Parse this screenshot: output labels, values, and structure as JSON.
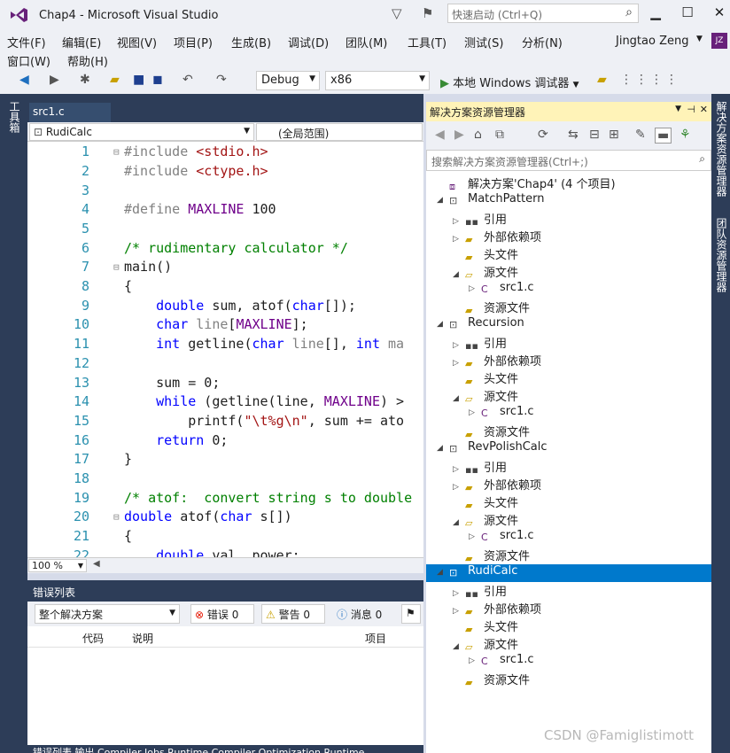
{
  "window": {
    "title": "Chap4 - Microsoft Visual Studio",
    "quick_launch": "快速启动 (Ctrl+Q)",
    "user": "Jingtao Zeng",
    "avatar": "JZ"
  },
  "menu": [
    "文件(F)",
    "编辑(E)",
    "视图(V)",
    "项目(P)",
    "生成(B)",
    "调试(D)",
    "团队(M)",
    "工具(T)",
    "测试(S)",
    "分析(N)",
    "窗口(W)",
    "帮助(H)"
  ],
  "toolbar": {
    "config": "Debug",
    "platform": "x86",
    "run_label": "本地 Windows 调试器"
  },
  "left_tab": "工具箱",
  "right_tabs": [
    "解决方案资源管理器",
    "团队资源管理器"
  ],
  "editor": {
    "tab": "src1.c",
    "scope_left": "RudiCalc",
    "scope_right": "(全局范围)",
    "zoom": "100 %",
    "lines": [
      {
        "n": "1",
        "t": "#include <stdio.h>"
      },
      {
        "n": "2",
        "t": "#include <ctype.h>"
      },
      {
        "n": "3",
        "t": ""
      },
      {
        "n": "4",
        "t": "#define MAXLINE 100"
      },
      {
        "n": "5",
        "t": ""
      },
      {
        "n": "6",
        "t": "/* rudimentary calculator */"
      },
      {
        "n": "7",
        "t": "main()"
      },
      {
        "n": "8",
        "t": "{"
      },
      {
        "n": "9",
        "t": "    double sum, atof(char[]);"
      },
      {
        "n": "10",
        "t": "    char line[MAXLINE];"
      },
      {
        "n": "11",
        "t": "    int getline(char line[], int ma"
      },
      {
        "n": "12",
        "t": ""
      },
      {
        "n": "13",
        "t": "    sum = 0;"
      },
      {
        "n": "14",
        "t": "    while (getline(line, MAXLINE) >"
      },
      {
        "n": "15",
        "t": "        printf(\"\\t%g\\n\", sum += ato"
      },
      {
        "n": "16",
        "t": "    return 0;"
      },
      {
        "n": "17",
        "t": "}"
      },
      {
        "n": "18",
        "t": ""
      },
      {
        "n": "19",
        "t": "/* atof:  convert string s to double"
      },
      {
        "n": "20",
        "t": "double atof(char s[])"
      },
      {
        "n": "21",
        "t": "{"
      },
      {
        "n": "22",
        "t": "    double val, power;"
      }
    ]
  },
  "error_list": {
    "title": "错误列表",
    "scope": "整个解决方案",
    "errors": "错误 0",
    "warnings": "警告 0",
    "messages": "消息 0",
    "col_code": "代码",
    "col_desc": "说明",
    "col_project": "项目",
    "bottom_tabs": "错误列表  输出  Compiler Jobs  Runtime Compiler Optimization  Runtime"
  },
  "solution_explorer": {
    "title": "解决方案资源管理器",
    "search": "搜索解决方案资源管理器(Ctrl+;)",
    "solution": "解决方案'Chap4' (4 个项目)",
    "projects": [
      {
        "name": "MatchPattern",
        "selected": false
      },
      {
        "name": "Recursion",
        "selected": false
      },
      {
        "name": "RevPolishCalc",
        "selected": false
      },
      {
        "name": "RudiCalc",
        "selected": true
      }
    ],
    "child_labels": {
      "refs": "引用",
      "ext": "外部依赖项",
      "headers": "头文件",
      "sources": "源文件",
      "file": "src1.c",
      "resources": "资源文件"
    }
  },
  "watermark": "CSDN @Famiglistimott"
}
